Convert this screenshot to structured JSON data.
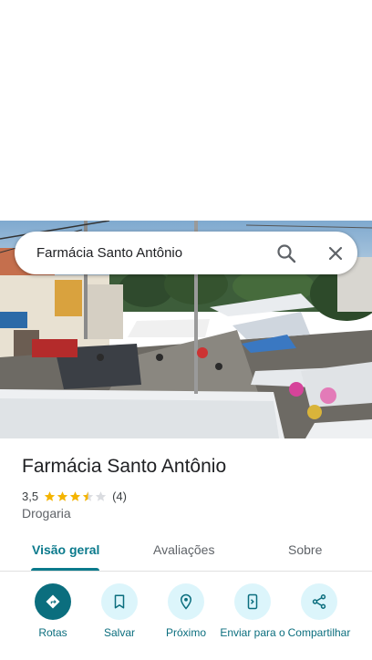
{
  "search": {
    "query": "Farmácia Santo Antônio"
  },
  "place": {
    "title": "Farmácia Santo Antônio",
    "rating": "3,5",
    "stars": 3.5,
    "review_count": "(4)",
    "category": "Drogaria"
  },
  "tabs": [
    {
      "label": "Visão geral",
      "active": true
    },
    {
      "label": "Avaliações",
      "active": false
    },
    {
      "label": "Sobre",
      "active": false
    }
  ],
  "actions": [
    {
      "label": "Rotas",
      "icon": "directions-icon"
    },
    {
      "label": "Salvar",
      "icon": "bookmark-icon"
    },
    {
      "label": "Próximo",
      "icon": "nearby-icon"
    },
    {
      "label": "Enviar para o",
      "icon": "send-to-phone-icon"
    },
    {
      "label": "Compartilhar",
      "icon": "share-icon"
    }
  ],
  "colors": {
    "accent": "#0b7a8c",
    "action_bg": "#dcf5fb",
    "star": "#f4b400"
  }
}
